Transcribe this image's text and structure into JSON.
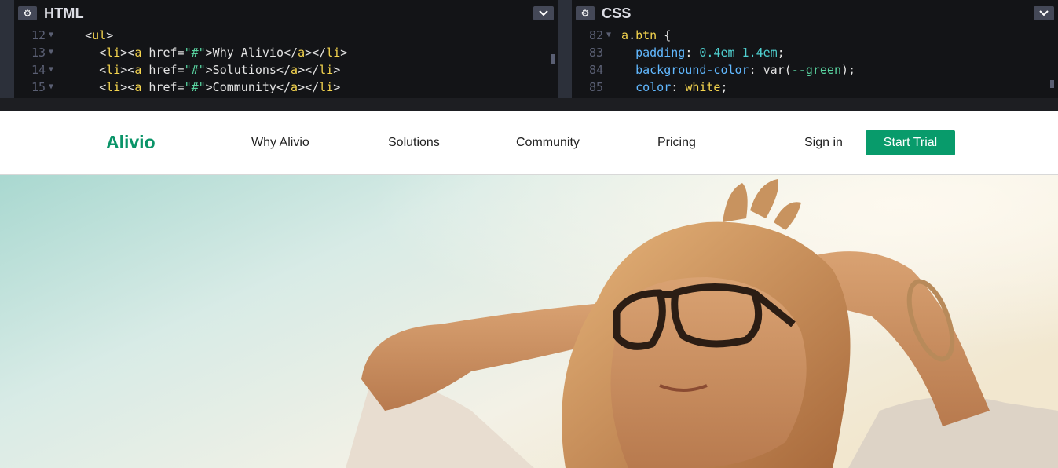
{
  "editor": {
    "html_pane": {
      "title": "HTML",
      "lines": [
        {
          "num": "12",
          "indent": "  ",
          "segments": [
            [
              "t-punc",
              "<"
            ],
            [
              "t-tag",
              "ul"
            ],
            [
              "t-punc",
              ">"
            ]
          ]
        },
        {
          "num": "13",
          "indent": "    ",
          "segments": [
            [
              "t-punc",
              "<"
            ],
            [
              "t-tag",
              "li"
            ],
            [
              "t-punc",
              "><"
            ],
            [
              "t-tag",
              "a"
            ],
            [
              "t-attr",
              " href="
            ],
            [
              "t-str",
              "\"#\""
            ],
            [
              "t-punc",
              ">Why Alivio</"
            ],
            [
              "t-tag",
              "a"
            ],
            [
              "t-punc",
              "></"
            ],
            [
              "t-tag",
              "li"
            ],
            [
              "t-punc",
              ">"
            ]
          ]
        },
        {
          "num": "14",
          "indent": "    ",
          "segments": [
            [
              "t-punc",
              "<"
            ],
            [
              "t-tag",
              "li"
            ],
            [
              "t-punc",
              "><"
            ],
            [
              "t-tag",
              "a"
            ],
            [
              "t-attr",
              " href="
            ],
            [
              "t-str",
              "\"#\""
            ],
            [
              "t-punc",
              ">Solutions</"
            ],
            [
              "t-tag",
              "a"
            ],
            [
              "t-punc",
              "></"
            ],
            [
              "t-tag",
              "li"
            ],
            [
              "t-punc",
              ">"
            ]
          ]
        },
        {
          "num": "15",
          "indent": "    ",
          "segments": [
            [
              "t-punc",
              "<"
            ],
            [
              "t-tag",
              "li"
            ],
            [
              "t-punc",
              "><"
            ],
            [
              "t-tag",
              "a"
            ],
            [
              "t-attr",
              " href="
            ],
            [
              "t-str",
              "\"#\""
            ],
            [
              "t-punc",
              ">Community</"
            ],
            [
              "t-tag",
              "a"
            ],
            [
              "t-punc",
              "></"
            ],
            [
              "t-tag",
              "li"
            ],
            [
              "t-punc",
              ">"
            ]
          ]
        }
      ]
    },
    "css_pane": {
      "title": "CSS",
      "lines": [
        {
          "num": "82",
          "arrow": true,
          "indent": "",
          "segments": [
            [
              "t-sel",
              "a"
            ],
            [
              "t-punc",
              "."
            ],
            [
              "t-sel",
              "btn"
            ],
            [
              "t-punc",
              " {"
            ]
          ]
        },
        {
          "num": "83",
          "arrow": false,
          "indent": "  ",
          "segments": [
            [
              "t-prop",
              "padding"
            ],
            [
              "t-punc",
              ": "
            ],
            [
              "t-num",
              "0.4em 1.4em"
            ],
            [
              "t-punc",
              ";"
            ]
          ]
        },
        {
          "num": "84",
          "arrow": false,
          "indent": "  ",
          "segments": [
            [
              "t-prop",
              "background-color"
            ],
            [
              "t-punc",
              ": var("
            ],
            [
              "t-var",
              "--green"
            ],
            [
              "t-punc",
              ");"
            ]
          ]
        },
        {
          "num": "85",
          "arrow": false,
          "indent": "  ",
          "segments": [
            [
              "t-prop",
              "color"
            ],
            [
              "t-punc",
              ": "
            ],
            [
              "t-white",
              "white"
            ],
            [
              "t-punc",
              ";"
            ]
          ]
        }
      ]
    }
  },
  "site": {
    "brand": "Alivio",
    "nav_links": [
      "Why Alivio",
      "Solutions",
      "Community",
      "Pricing"
    ],
    "sign_in": "Sign in",
    "cta": "Start Trial"
  },
  "colors": {
    "brand_green": "#0a9468",
    "button_green": "#089b6b",
    "editor_bg": "#131417",
    "editor_chrome": "#2c303a"
  },
  "icons": {
    "settings": "gear-icon",
    "collapse": "chevron-down-icon"
  }
}
